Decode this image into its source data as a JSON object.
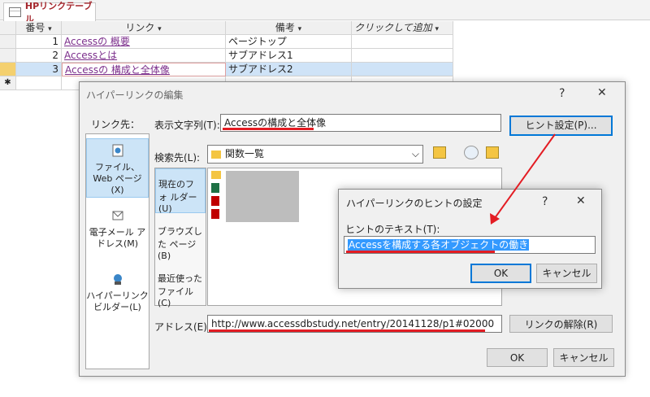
{
  "table_tab": {
    "label": "HPリンクテーブル"
  },
  "columns": {
    "number": "番号",
    "link": "リンク",
    "note": "備考",
    "add": "クリックして追加"
  },
  "rows": [
    {
      "number": "1",
      "link": "Accessの 概要",
      "note": "ページトップ"
    },
    {
      "number": "2",
      "link": "Accessとは",
      "note": "サブアドレス1"
    },
    {
      "number": "3",
      "link": "Accessの 構成と全体像",
      "note": "サブアドレス2"
    }
  ],
  "new_row_marker": "✱",
  "dialog": {
    "title": "ハイパーリンクの編集",
    "help_label": "?",
    "close_label": "✕",
    "link_to_label": "リンク先：",
    "display_text_label": "表示文字列(T):",
    "display_text_value": "Accessの構成と全体像",
    "hint_button_label": "ヒント設定(P)...",
    "search_label": "検索先(L):",
    "search_folder": "関数一覧",
    "sidebar": [
      {
        "label": "ファイル、Web ページ(X)"
      },
      {
        "label": "電子メール アドレス(M)"
      },
      {
        "label": "ハイパーリンク ビルダー(L)"
      }
    ],
    "subnav": [
      {
        "label": "現在のフォ ルダー(U)"
      },
      {
        "label": "ブラウズした ページ(B)"
      },
      {
        "label": "最近使った ファイル(C)"
      }
    ],
    "address_label": "アドレス(E):",
    "address_value": "http://www.accessdbstudy.net/entry/20141128/p1#02000",
    "remove_link_label": "リンクの解除(R)",
    "ok_label": "OK",
    "cancel_label": "キャンセル"
  },
  "hint_dialog": {
    "title": "ハイパーリンクのヒントの設定",
    "help_label": "?",
    "close_label": "✕",
    "text_label": "ヒントのテキスト(T):",
    "text_value": "Accessを構成する各オブジェクトの働き",
    "ok_label": "OK",
    "cancel_label": "キャンセル"
  },
  "colors": {
    "accent": "#0078d7",
    "annotation_red": "#e31c23",
    "link_purple": "#7b2d8b",
    "row_highlight": "#cfe3f7"
  }
}
